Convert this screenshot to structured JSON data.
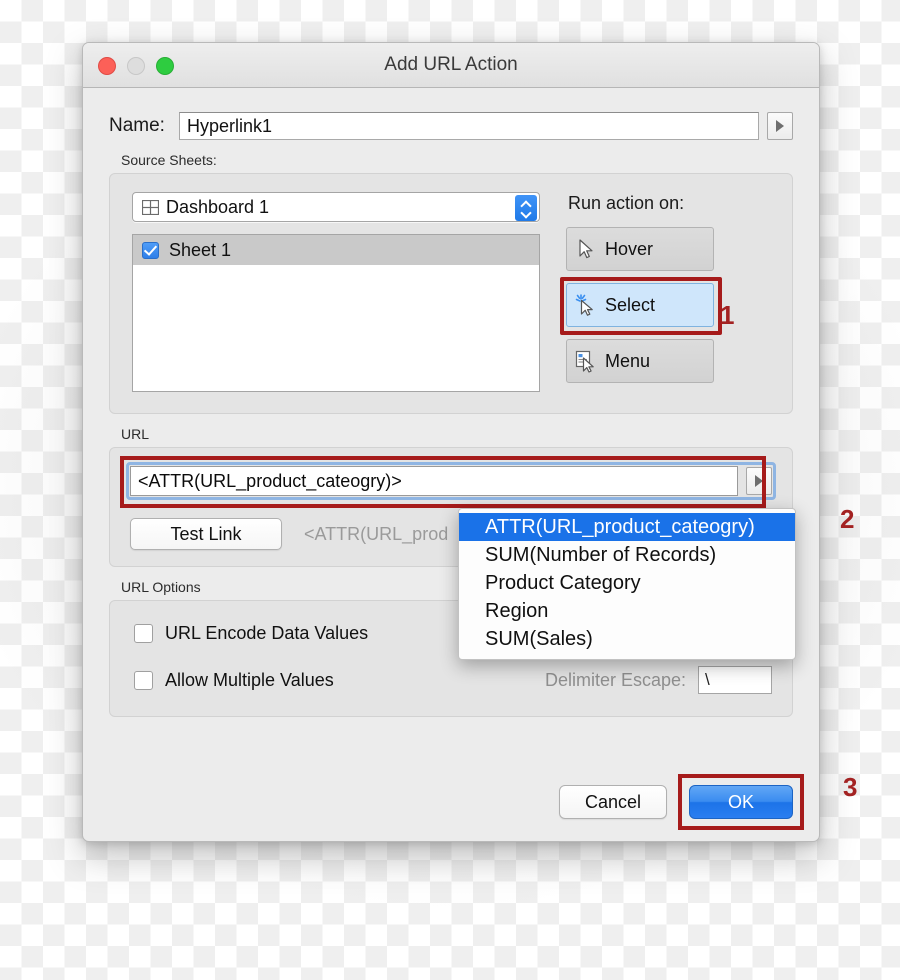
{
  "window": {
    "title": "Add URL Action",
    "traffic_lights": [
      "close-button",
      "minimize-button",
      "zoom-button"
    ]
  },
  "name_row": {
    "label": "Name:",
    "value": "Hyperlink1",
    "menu_button_icon": "triangle-right-icon"
  },
  "source_sheets": {
    "label": "Source Sheets:",
    "dashboard_select": {
      "value": "Dashboard 1",
      "icon": "dashboard-grid-icon"
    },
    "sheets": [
      {
        "label": "Sheet 1",
        "checked": true,
        "selected": true
      }
    ],
    "run_action": {
      "label": "Run action on:",
      "options": [
        {
          "label": "Hover",
          "icon": "cursor-arrow-icon",
          "active": false
        },
        {
          "label": "Select",
          "icon": "cursor-sparkle-icon",
          "active": true
        },
        {
          "label": "Menu",
          "icon": "cursor-menu-panel-icon",
          "active": false
        }
      ]
    }
  },
  "url_section": {
    "label": "URL",
    "value": "<ATTR(URL_product_cateogry)>",
    "menu_button_icon": "triangle-right-icon",
    "test_link_label": "Test Link",
    "preview_text": "<ATTR(URL_prod"
  },
  "url_options": {
    "label": "URL Options",
    "checkboxes": [
      {
        "label": "URL Encode Data Values",
        "checked": false
      },
      {
        "label": "Allow Multiple Values",
        "checked": false
      }
    ],
    "delimiter_escape": {
      "label": "Delimiter Escape:",
      "value": "\\"
    }
  },
  "footer": {
    "cancel_label": "Cancel",
    "ok_label": "OK"
  },
  "popup_menu": {
    "items": [
      {
        "label": "ATTR(URL_product_cateogry)",
        "selected": true
      },
      {
        "label": "SUM(Number of Records)",
        "selected": false
      },
      {
        "label": "Product Category",
        "selected": false
      },
      {
        "label": "Region",
        "selected": false
      },
      {
        "label": "SUM(Sales)",
        "selected": false
      }
    ]
  },
  "annotations": [
    {
      "text": "1"
    },
    {
      "text": "2"
    },
    {
      "text": "3"
    }
  ],
  "colors": {
    "annotation_red": "#a32222",
    "highlight_red": "#a61b1b",
    "accent_blue": "#1a72e8",
    "selection_blue": "#cfe6fb"
  }
}
